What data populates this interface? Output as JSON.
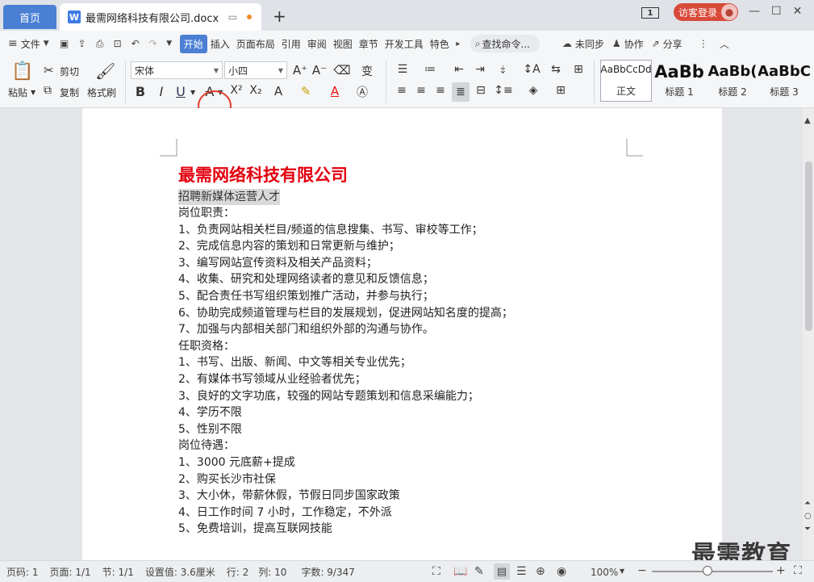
{
  "titlebar": {
    "home_tab": "首页",
    "doc_tab": "最需网络科技有限公司.docx",
    "window_count": "1",
    "login": "访客登录"
  },
  "menu": {
    "file": "文件",
    "items": [
      "开始",
      "插入",
      "页面布局",
      "引用",
      "审阅",
      "视图",
      "章节",
      "开发工具",
      "特色"
    ],
    "active": "开始",
    "search": "查找命令...",
    "unsynced": "未同步",
    "collab": "协作",
    "share": "分享"
  },
  "ribbon": {
    "paste": "粘贴",
    "cut": "剪切",
    "copy": "复制",
    "format_painter": "格式刷",
    "font_name": "宋体",
    "font_size": "小四",
    "styles": [
      {
        "preview": "AaBbCcDd",
        "label": "正文"
      },
      {
        "preview": "AaBb",
        "label": "标题 1"
      },
      {
        "preview": "AaBb(",
        "label": "标题 2"
      },
      {
        "preview": "AaBbC",
        "label": "标题 3"
      }
    ]
  },
  "document": {
    "title": "最需网络科技有限公司",
    "subtitle": "招聘新媒体运营人才",
    "lines": [
      "岗位职责：",
      "1、负责网站相关栏目/频道的信息搜集、书写、审校等工作；",
      "2、完成信息内容的策划和日常更新与维护；",
      "3、编写网站宣传资料及相关产品资料；",
      "4、收集、研究和处理网络读者的意见和反馈信息；",
      "5、配合责任书写组织策划推广活动，并参与执行；",
      "6、协助完成频道管理与栏目的发展规划，促进网站知名度的提高；",
      "7、加强与内部相关部门和组织外部的沟通与协作。",
      "任职资格：",
      "1、书写、出版、新闻、中文等相关专业优先；",
      "2、有媒体书写领域从业经验者优先；",
      "3、良好的文字功底，较强的网站专题策划和信息采编能力；",
      "4、学历不限",
      "5、性别不限",
      "岗位待遇：",
      "1、3000 元底薪+提成",
      "2、购买长沙市社保",
      "3、大小休，带薪休假，节假日同步国家政策",
      "4、日工作时间 7 小时，工作稳定，不外派",
      "5、免费培训，提高互联网技能"
    ]
  },
  "status": {
    "page_no": "页码: 1",
    "pages": "页面: 1/1",
    "section": "节: 1/1",
    "setting": "设置值: 3.6厘米",
    "row": "行: 2",
    "col": "列: 10",
    "wordcount": "字数: 9/347",
    "zoom": "100%"
  },
  "watermark": "最需教育",
  "colors": {
    "accent": "#4a7fd4",
    "title_red": "#e3000f",
    "login_red": "#d84a3a",
    "highlight": "#d9d9d9"
  }
}
